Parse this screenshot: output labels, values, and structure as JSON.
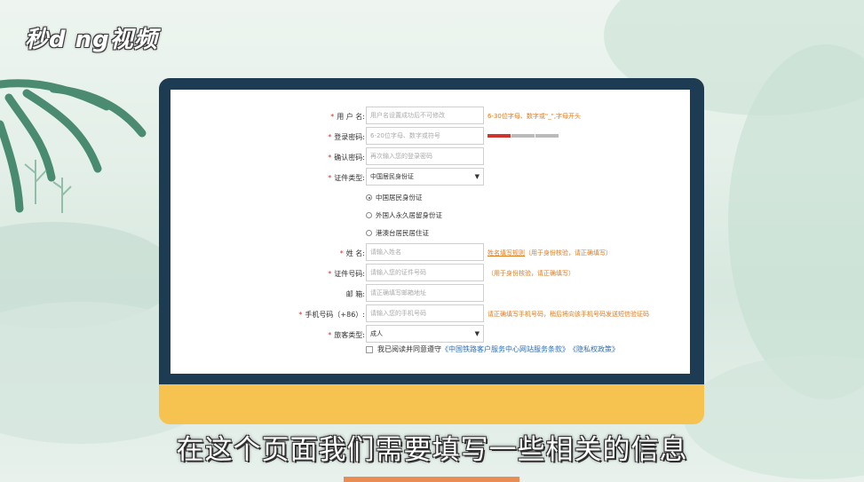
{
  "logo": {
    "text": "秒d ng视频"
  },
  "form": {
    "username": {
      "label": "用 户 名:",
      "placeholder": "用户名设置成功后不可修改",
      "hint": "6-30位字母、数字或\"_\",字母开头"
    },
    "password": {
      "label": "登录密码:",
      "placeholder": "6-20位字母、数字或符号",
      "strength_colors": [
        "#d0342c",
        "#bbbbbb",
        "#bbbbbb",
        "#bbbbbb"
      ]
    },
    "confirm": {
      "label": "确认密码:",
      "placeholder": "再次输入您的登录密码"
    },
    "id_type": {
      "label": "证件类型:",
      "value": "中国居民身份证"
    },
    "id_options": [
      {
        "label": "中国居民身份证",
        "selected": true
      },
      {
        "label": "外国人永久居留身份证",
        "selected": false
      },
      {
        "label": "港澳台居民居住证",
        "selected": false
      }
    ],
    "name": {
      "label": "姓 名:",
      "placeholder": "请输入姓名",
      "hint_link": "姓名填写规则",
      "hint": "（用于身份核验，请正确填写）"
    },
    "id_number": {
      "label": "证件号码:",
      "placeholder": "请输入您的证件号码",
      "hint": "（用于身份核验，请正确填写）"
    },
    "email": {
      "label": "邮 箱:",
      "placeholder": "请正确填写邮箱地址"
    },
    "phone": {
      "label": "手机号码（+86）:",
      "placeholder": "请输入您的手机号码",
      "hint": "请正确填写手机号码，稍后将向该手机号码发送短信验证码"
    },
    "passenger_type": {
      "label": "旅客类型:",
      "value": "成人"
    },
    "agree": {
      "text": "我已阅读并同意遵守",
      "link1": "《中国铁路客户服务中心网站服务条款》",
      "link2": "《隐私权政策》"
    }
  },
  "subtitle": "在这个页面我们需要填写一些相关的信息",
  "colors": {
    "monitor_frame": "#f6c350",
    "bezel": "#1d3b52",
    "required": "#d0342c",
    "hint": "#e07a1f",
    "link": "#2a6fb8"
  }
}
